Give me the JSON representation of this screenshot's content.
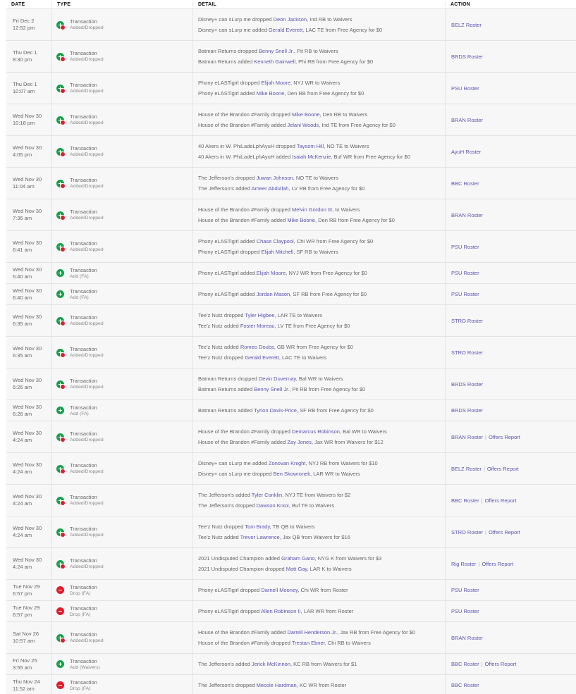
{
  "headers": {
    "date": "DATE",
    "type": "TYPE",
    "detail": "DETAIL",
    "action": "ACTION"
  },
  "rows": [
    {
      "day": "Fri Dec 2",
      "time": "12:52 pm",
      "t1": "Transaction",
      "t2": "Added/Dropped",
      "icon": "addrop",
      "lines": [
        [
          "Disney+ can sLurp me dropped ",
          "Deon Jackson",
          ", Ind RB to Waivers"
        ],
        [
          "Disney+ can sLurp me added ",
          "Gerald Everett",
          ", LAC TE from Free Agency for $0"
        ]
      ],
      "actions": [
        "BELZ Roster"
      ]
    },
    {
      "day": "Thu Dec 1",
      "time": "8:30 pm",
      "t1": "Transaction",
      "t2": "Added/Dropped",
      "icon": "addrop",
      "lines": [
        [
          "Batman Returns dropped ",
          "Benny Snell Jr.",
          ", Pit RB to Waivers"
        ],
        [
          "Batman Returns added ",
          "Kenneth Gainwell",
          ", Phi RB from Free Agency for $0"
        ]
      ],
      "actions": [
        "BRDS Roster"
      ]
    },
    {
      "day": "Thu Dec 1",
      "time": "10:07 am",
      "t1": "Transaction",
      "t2": "Added/Dropped",
      "icon": "addrop",
      "lines": [
        [
          "Phony eLASTigirl dropped ",
          "Elijah Moore",
          ", NYJ WR to Waivers"
        ],
        [
          "Phony eLASTigirl added ",
          "Mike Boone",
          ", Den RB from Free Agency for $0"
        ]
      ],
      "actions": [
        "PSU Roster"
      ]
    },
    {
      "day": "Wed Nov 30",
      "time": "10:18 pm",
      "t1": "Transaction",
      "t2": "Added/Dropped",
      "icon": "addrop",
      "lines": [
        [
          "House of the Brandon #Family dropped ",
          "Mike Boone",
          ", Den RB to Waivers"
        ],
        [
          "House of the Brandon #Family added ",
          "Jelani Woods",
          ", Ind TE from Free Agency for $0"
        ]
      ],
      "actions": [
        "BRAN Roster"
      ]
    },
    {
      "day": "Wed Nov 30",
      "time": "4:05 pm",
      "t1": "Transaction",
      "t2": "Added/Dropped",
      "icon": "addrop",
      "lines": [
        [
          "40 Akers in W. PhiLadeLphAyuH dropped ",
          "Taysom Hill",
          ", NO TE to Waivers"
        ],
        [
          "40 Akers in W. PhiLadeLphAyuH added ",
          "Isaiah McKenzie",
          ", Buf WR from Free Agency for $0"
        ]
      ],
      "actions": [
        "AyuH Roster"
      ]
    },
    {
      "day": "Wed Nov 30",
      "time": "11:04 am",
      "t1": "Transaction",
      "t2": "Added/Dropped",
      "icon": "addrop",
      "lines": [
        [
          "The Jefferson's dropped ",
          "Juwan Johnson",
          ", NO TE to Waivers"
        ],
        [
          "The Jefferson's added ",
          "Ameer Abdullah",
          ", LV RB from Free Agency for $0"
        ]
      ],
      "actions": [
        "BBC Roster"
      ]
    },
    {
      "day": "Wed Nov 30",
      "time": "7:36 am",
      "t1": "Transaction",
      "t2": "Added/Dropped",
      "icon": "addrop",
      "lines": [
        [
          "House of the Brandon #Family dropped ",
          "Melvin Gordon III",
          ", to Waivers"
        ],
        [
          "House of the Brandon #Family added ",
          "Mike Boone",
          ", Den RB from Free Agency for $0"
        ]
      ],
      "actions": [
        "BRAN Roster"
      ]
    },
    {
      "day": "Wed Nov 30",
      "time": "6:41 am",
      "t1": "Transaction",
      "t2": "Added/Dropped",
      "icon": "addrop",
      "lines": [
        [
          "Phony eLASTigirl added ",
          "Chase Claypool",
          ", Chi WR from Free Agency for $0"
        ],
        [
          "Phony eLASTigirl dropped ",
          "Elijah Mitchell",
          ", SF RB to Waivers"
        ]
      ],
      "actions": [
        "PSU Roster"
      ]
    },
    {
      "day": "Wed Nov 30",
      "time": "6:40 am",
      "t1": "Transaction",
      "t2": "Add (FA)",
      "icon": "add",
      "lines": [
        [
          "Phony eLASTigirl added ",
          "Elijah Moore",
          ", NYJ WR from Free Agency for $0"
        ]
      ],
      "actions": [
        "PSU Roster"
      ]
    },
    {
      "day": "Wed Nov 30",
      "time": "6:40 am",
      "t1": "Transaction",
      "t2": "Add (FA)",
      "icon": "add",
      "lines": [
        [
          "Phony eLASTigirl added ",
          "Jordan Mason",
          ", SF RB from Free Agency for $0"
        ]
      ],
      "actions": [
        "PSU Roster"
      ]
    },
    {
      "day": "Wed Nov 30",
      "time": "6:35 am",
      "t1": "Transaction",
      "t2": "Added/Dropped",
      "icon": "addrop",
      "lines": [
        [
          "Tee'z Nutz dropped ",
          "Tyler Higbee",
          ", LAR TE to Waivers"
        ],
        [
          "Tee'z Nutz added ",
          "Foster Moreau",
          ", LV TE from Free Agency for $0"
        ]
      ],
      "actions": [
        "STRO Roster"
      ]
    },
    {
      "day": "Wed Nov 30",
      "time": "6:35 am",
      "t1": "Transaction",
      "t2": "Added/Dropped",
      "icon": "addrop",
      "lines": [
        [
          "Tee'z Nutz added ",
          "Romeo Doubs",
          ", GB WR from Free Agency for $0"
        ],
        [
          "Tee'z Nutz dropped ",
          "Gerald Everett",
          ", LAC TE to Waivers"
        ]
      ],
      "actions": [
        "STRO Roster"
      ]
    },
    {
      "day": "Wed Nov 30",
      "time": "6:26 am",
      "t1": "Transaction",
      "t2": "Added/Dropped",
      "icon": "addrop",
      "lines": [
        [
          "Batman Returns dropped ",
          "Devin Duvernay",
          ", Bal WR to Waivers"
        ],
        [
          "Batman Returns added ",
          "Benny Snell Jr.",
          ", Pit RB from Free Agency for $0"
        ]
      ],
      "actions": [
        "BRDS Roster"
      ]
    },
    {
      "day": "Wed Nov 30",
      "time": "6:26 am",
      "t1": "Transaction",
      "t2": "Add (FA)",
      "icon": "add",
      "lines": [
        [
          "Batman Returns added ",
          "Tyrion Davis-Price",
          ", SF RB from Free Agency for $0"
        ]
      ],
      "actions": [
        "BRDS Roster"
      ]
    },
    {
      "day": "Wed Nov 30",
      "time": "4:24 am",
      "t1": "Transaction",
      "t2": "Added/Dropped",
      "icon": "addrop",
      "lines": [
        [
          "House of the Brandon #Family dropped ",
          "Demarcus Robinson",
          ", Bal WR to Waivers"
        ],
        [
          "House of the Brandon #Family added ",
          "Zay Jones",
          ", Jax WR from Waivers for $12"
        ]
      ],
      "actions": [
        "BRAN Roster",
        "Offers Report"
      ]
    },
    {
      "day": "Wed Nov 30",
      "time": "4:24 am",
      "t1": "Transaction",
      "t2": "Added/Dropped",
      "icon": "addrop",
      "lines": [
        [
          "Disney+ can sLurp me added ",
          "Zonovan Knight",
          ", NYJ RB from Waivers for $10"
        ],
        [
          "Disney+ can sLurp me dropped ",
          "Ben Skowronek",
          ", LAR WR to Waivers"
        ]
      ],
      "actions": [
        "BELZ Roster",
        "Offers Report"
      ]
    },
    {
      "day": "Wed Nov 30",
      "time": "4:24 am",
      "t1": "Transaction",
      "t2": "Added/Dropped",
      "icon": "addrop",
      "lines": [
        [
          "The Jefferson's added ",
          "Tyler Conklin",
          ", NYJ TE from Waivers for $2"
        ],
        [
          "The Jefferson's dropped ",
          "Dawson Knox",
          ", Buf TE to Waivers"
        ]
      ],
      "actions": [
        "BBC Roster",
        "Offers Report"
      ]
    },
    {
      "day": "Wed Nov 30",
      "time": "4:24 am",
      "t1": "Transaction",
      "t2": "Added/Dropped",
      "icon": "addrop",
      "lines": [
        [
          "Tee'z Nutz dropped ",
          "Tom Brady",
          ", TB QB to Waivers"
        ],
        [
          "Tee'z Nutz added ",
          "Trevor Lawrence",
          ", Jax QB from Waivers for $16"
        ]
      ],
      "actions": [
        "STRO Roster",
        "Offers Report"
      ]
    },
    {
      "day": "Wed Nov 30",
      "time": "4:24 am",
      "t1": "Transaction",
      "t2": "Added/Dropped",
      "icon": "addrop",
      "lines": [
        [
          "2021 Undisputed Champion added ",
          "Graham Gano",
          ", NYG K from Waivers for $3"
        ],
        [
          "2021 Undisputed Champion dropped ",
          "Matt Gay",
          ", LAR K to Waivers"
        ]
      ],
      "actions": [
        "Rig Roster",
        "Offers Report"
      ]
    },
    {
      "day": "Tue Nov 29",
      "time": "6:57 pm",
      "t1": "Transaction",
      "t2": "Drop (FA)",
      "icon": "drop",
      "lines": [
        [
          "Phony eLASTigirl dropped ",
          "Darnell Mooney",
          ", Chi WR from Roster"
        ]
      ],
      "actions": [
        "PSU Roster"
      ]
    },
    {
      "day": "Tue Nov 29",
      "time": "6:57 pm",
      "t1": "Transaction",
      "t2": "Drop (FA)",
      "icon": "drop",
      "lines": [
        [
          "Phony eLASTigirl dropped ",
          "Allen Robinson II",
          ", LAR WR from Roster"
        ]
      ],
      "actions": [
        "PSU Roster"
      ]
    },
    {
      "day": "Sat Nov 26",
      "time": "10:57 am",
      "t1": "Transaction",
      "t2": "Added/Dropped",
      "icon": "addrop",
      "lines": [
        [
          "House of the Brandon #Family added ",
          "Darrell Henderson Jr.",
          ", Jax RB from Free Agency for $0"
        ],
        [
          "House of the Brandon #Family dropped ",
          "Trestan Ebner",
          ", Chi RB to Waivers"
        ]
      ],
      "actions": [
        "BRAN Roster"
      ]
    },
    {
      "day": "Fri Nov 25",
      "time": "3:55 am",
      "t1": "Transaction",
      "t2": "Add (Waivers)",
      "icon": "add",
      "lines": [
        [
          "The Jefferson's added ",
          "Jerick McKinnon",
          ", KC RB from Waivers for $1"
        ]
      ],
      "actions": [
        "BBC Roster",
        "Offers Report"
      ]
    },
    {
      "day": "Thu Nov 24",
      "time": "11:52 am",
      "t1": "Transaction",
      "t2": "Drop (FA)",
      "icon": "drop",
      "lines": [
        [
          "The Jefferson's dropped ",
          "Mecole Hardman",
          ", KC WR from Roster"
        ]
      ],
      "actions": [
        "BBC Roster"
      ]
    }
  ]
}
